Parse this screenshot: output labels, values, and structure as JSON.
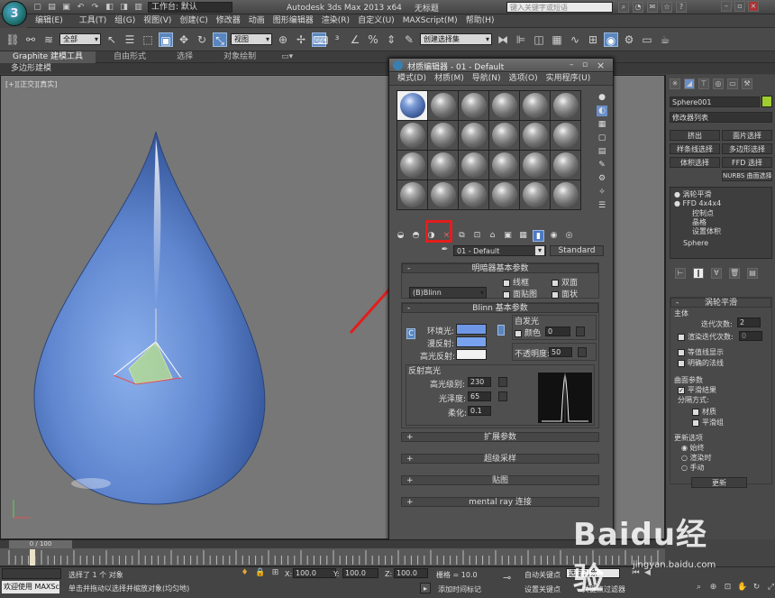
{
  "app": {
    "title": "Autodesk 3ds Max  2013 x64",
    "file": "无标题",
    "workspace_label": "工作台: 默认",
    "search_placeholder": "键入关键字或短语",
    "logo": "3"
  },
  "menubar": [
    "编辑(E)",
    "工具(T)",
    "组(G)",
    "视图(V)",
    "创建(C)",
    "修改器",
    "动画",
    "图形编辑器",
    "渲染(R)",
    "自定义(U)",
    "MAXScript(M)",
    "帮助(H)"
  ],
  "toolbar": {
    "selection_filter": "全部",
    "reference_coord": "视图",
    "named_selection": "创建选择集"
  },
  "ribbon": {
    "tabs": [
      "Graphite 建模工具",
      "自由形式",
      "选择",
      "对象绘制"
    ],
    "sub_label": "多边形建模"
  },
  "viewport": {
    "label": "[+][正交][真实]"
  },
  "material_editor": {
    "title": "材质编辑器 - 01 - Default",
    "menu": [
      "模式(D)",
      "材质(M)",
      "导航(N)",
      "选项(O)",
      "实用程序(U)"
    ],
    "material_name": "01 - Default",
    "material_type": "Standard",
    "shader_rollup": "明暗器基本参数",
    "shader": "(B)Blinn",
    "checkboxes": {
      "wire": "线框",
      "two_sided": "双面",
      "face_map": "面贴图",
      "faceted": "面状"
    },
    "blinn_rollup": "Blinn 基本参数",
    "self_illum": "自发光",
    "color_label": "颜色",
    "self_illum_value": "0",
    "ambient": "环境光:",
    "diffuse": "漫反射:",
    "specular": "高光反射:",
    "opacity_label": "不透明度:",
    "opacity_value": "50",
    "specular_hl": "反射高光",
    "spec_level_label": "高光级别:",
    "spec_level": "230",
    "glossiness_label": "光泽度:",
    "glossiness": "65",
    "soften_label": "柔化:",
    "soften": "0.1",
    "rollups": [
      "扩展参数",
      "超级采样",
      "贴图",
      "mental ray 连接"
    ],
    "colors": {
      "ambient": "#6f97e6",
      "diffuse": "#79a2ee",
      "specular": "#f2f2f2"
    }
  },
  "command_panel": {
    "object_name": "Sphere001",
    "modifier_list": "修改器列表",
    "buttons": [
      "挤出",
      "面片选择",
      "样条线选择",
      "多边形选择",
      "体积选择",
      "FFD 选择",
      "NURBS 曲面选择"
    ],
    "stack": [
      "涡轮平滑",
      "FFD 4x4x4",
      "控制点",
      "晶格",
      "设置体积",
      "Sphere"
    ],
    "turbosmooth": {
      "title": "涡轮平滑",
      "main": "主体",
      "iterations_label": "迭代次数:",
      "iterations": "2",
      "render_iters_label": "渲染迭代次数:",
      "render_iters": "0",
      "isoline": "等值线显示",
      "explicit_normals": "明确的法线",
      "surface_params": "曲面参数",
      "smooth_result": "平滑结果",
      "separate_by": "分隔方式:",
      "materials": "材质",
      "smoothing_groups": "平滑组",
      "update_options": "更新选项",
      "always": "始终",
      "when_rendering": "渲染时",
      "manually": "手动",
      "update_button": "更新"
    }
  },
  "timeline": {
    "frame": "0 / 100"
  },
  "status": {
    "welcome": "欢迎使用 MAXSc",
    "selected": "选择了 1 个 对象",
    "hint": "单击并拖动以选择并缩放对象(均匀地)",
    "x_label": "X:",
    "x_value": "100.0",
    "y_label": "Y:",
    "y_value": "100.0",
    "z_label": "Z:",
    "z_value": "100.0",
    "grid": "栅格 = 10.0",
    "add_time_tag": "添加时间标记",
    "auto_key": "自动关键点",
    "set_key": "设置关键点",
    "selected_obj": "选定对象",
    "key_filters": "关键点过滤器"
  },
  "watermark": {
    "main": "Baidu经验",
    "url": "jingyan.baidu.com"
  }
}
